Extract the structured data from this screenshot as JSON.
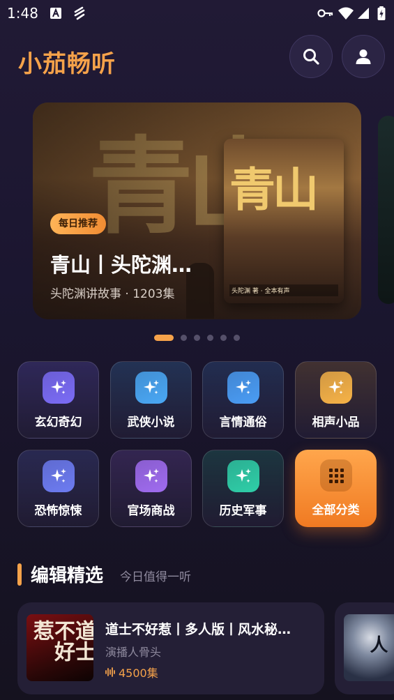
{
  "status_bar": {
    "time": "1:48"
  },
  "header": {
    "title": "小茄畅听"
  },
  "banner": {
    "badge": "每日推荐",
    "title": "青山丨头陀渊…",
    "subtitle": "头陀渊讲故事 · 1203集",
    "cover_title": "青山",
    "cover_caption": "头陀渊 著 · 全本有声",
    "carousel_total": 6,
    "carousel_active": 0
  },
  "categories": [
    {
      "label": "玄幻奇幻",
      "color": "#7b6cf6",
      "icon": "sparkle-icon"
    },
    {
      "label": "武侠小说",
      "color": "#4aa8f5",
      "icon": "sparkle-icon"
    },
    {
      "label": "言情通俗",
      "color": "#4a9df5",
      "icon": "sparkle-icon"
    },
    {
      "label": "相声小品",
      "color": "#f7b347",
      "icon": "sparkle-icon"
    },
    {
      "label": "恐怖惊悚",
      "color": "#6d7cf2",
      "icon": "sparkle-icon"
    },
    {
      "label": "官场商战",
      "color": "#a06cf0",
      "icon": "sparkle-icon"
    },
    {
      "label": "历史军事",
      "color": "#2fcfa8",
      "icon": "sparkle-icon"
    },
    {
      "label": "全部分类",
      "color": "#f08c33",
      "icon": "grid-icon"
    }
  ],
  "section": {
    "title": "编辑精选",
    "subtitle": "今日值得一听"
  },
  "picks": [
    {
      "title": "道士不好惹丨多人版丨风水秘…",
      "narrator": "演播人骨头",
      "count": "4500集",
      "cover_text": "道士不好惹"
    },
    {
      "title": "",
      "narrator": "",
      "count": "",
      "cover_text": "打更人"
    }
  ]
}
